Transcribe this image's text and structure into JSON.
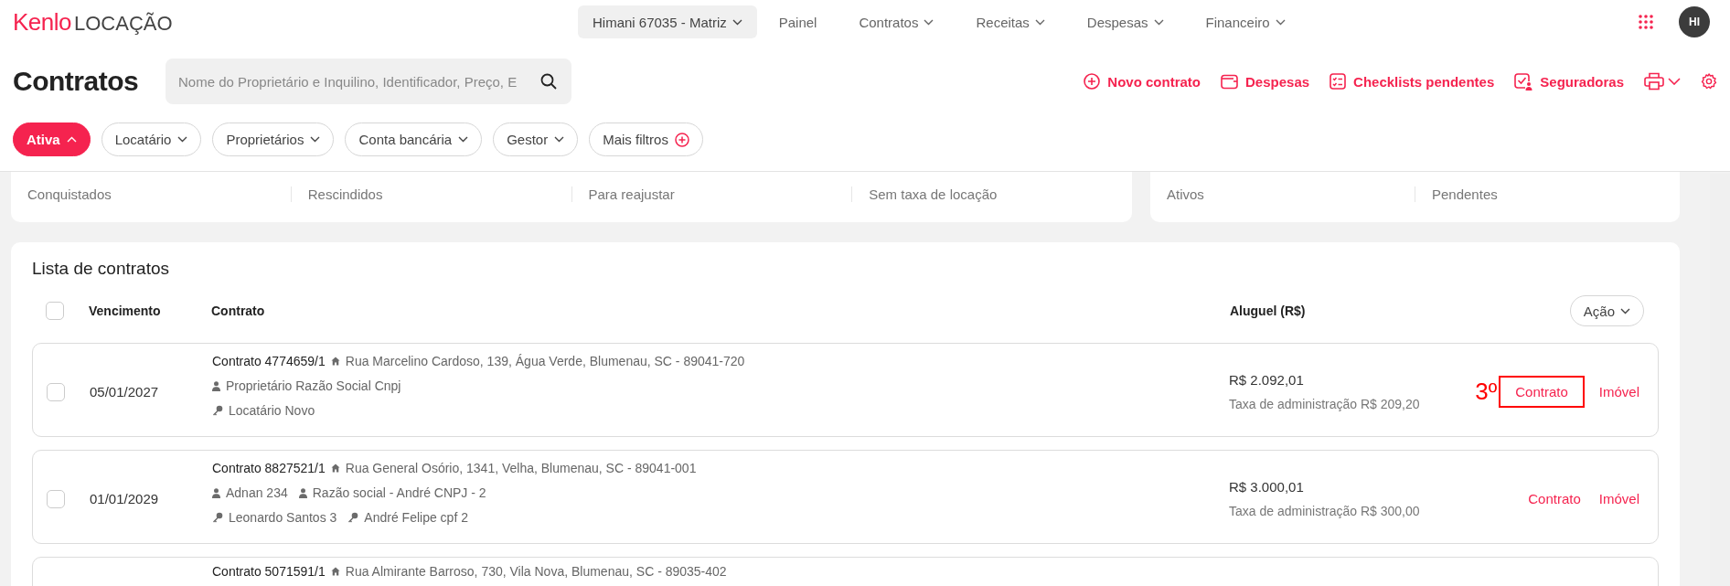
{
  "brand": {
    "logo": "Kenlo",
    "product": "LOCAÇÃO"
  },
  "org_selector": {
    "label": "Himani 67035 - Matriz"
  },
  "nav": [
    {
      "label": "Painel",
      "has_menu": false
    },
    {
      "label": "Contratos",
      "has_menu": true
    },
    {
      "label": "Receitas",
      "has_menu": true
    },
    {
      "label": "Despesas",
      "has_menu": true
    },
    {
      "label": "Financeiro",
      "has_menu": true
    }
  ],
  "avatar": {
    "initials": "HI"
  },
  "page_title": "Contratos",
  "search": {
    "placeholder": "Nome do Proprietário e Inquilino, Identificador, Preço, E"
  },
  "actions": [
    {
      "label": "Novo contrato",
      "kind": "add"
    },
    {
      "label": "Despesas",
      "kind": "wallet"
    },
    {
      "label": "Checklists pendentes",
      "kind": "checklist"
    },
    {
      "label": "Seguradoras",
      "kind": "insurer"
    }
  ],
  "filters": [
    {
      "label": "Ativa",
      "selected": true,
      "kind": "dropdown"
    },
    {
      "label": "Locatário",
      "selected": false,
      "kind": "dropdown"
    },
    {
      "label": "Proprietários",
      "selected": false,
      "kind": "dropdown"
    },
    {
      "label": "Conta bancária",
      "selected": false,
      "kind": "dropdown"
    },
    {
      "label": "Gestor",
      "selected": false,
      "kind": "dropdown"
    },
    {
      "label": "Mais filtros",
      "selected": false,
      "kind": "add"
    }
  ],
  "stat_cards": [
    {
      "labels": [
        "Conquistados",
        "Rescindidos",
        "Para reajustar",
        "Sem taxa de locação"
      ]
    },
    {
      "labels": [
        "Ativos",
        "Pendentes"
      ]
    }
  ],
  "list": {
    "title": "Lista de contratos",
    "select_all_checked": false,
    "columns": [
      "Vencimento",
      "Contrato",
      "Aluguel (R$)"
    ],
    "action_button": "Ação",
    "rows": [
      {
        "checked": false,
        "due": "05/01/2027",
        "contract": "Contrato 4774659/1",
        "address": "Rua Marcelino Cardoso, 139, Água Verde, Blumenau, SC - 89041-720",
        "owners": [
          "Proprietário Razão Social Cnpj"
        ],
        "tenants": [
          "Locatário Novo"
        ],
        "rent": "R$ 2.092,01",
        "fee": "Taxa de administração R$ 209,20",
        "links": [
          "Contrato",
          "Imóvel"
        ],
        "annotation": "3º"
      },
      {
        "checked": false,
        "due": "01/01/2029",
        "contract": "Contrato 8827521/1",
        "address": "Rua General Osório, 1341, Velha, Blumenau, SC - 89041-001",
        "owners": [
          "Adnan 234",
          "Razão social - André CNPJ - 2"
        ],
        "tenants": [
          "Leonardo Santos 3",
          "André Felipe cpf 2"
        ],
        "rent": "R$ 3.000,01",
        "fee": "Taxa de administração R$ 300,00",
        "links": [
          "Contrato",
          "Imóvel"
        ]
      },
      {
        "contract": "Contrato 5071591/1",
        "address": "Rua Almirante Barroso, 730, Vila Nova, Blumenau, SC - 89035-402"
      }
    ]
  }
}
